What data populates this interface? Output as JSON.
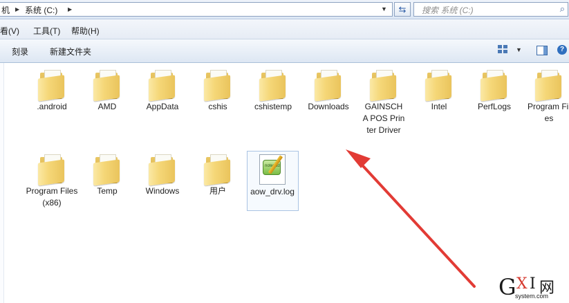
{
  "addressbar": {
    "crumb_computer": "机",
    "crumb_drive": "系统 (C:)",
    "search_placeholder": "搜索 系统 (C:)"
  },
  "menubar": {
    "items": [
      {
        "label": "查看(V)"
      },
      {
        "label": "工具(T)"
      },
      {
        "label": "帮助(H)"
      }
    ]
  },
  "toolbar": {
    "burn_label": "刻录",
    "new_folder_label": "新建文件夹",
    "help_glyph": "?"
  },
  "files": [
    {
      "name": ".android",
      "type": "folder"
    },
    {
      "name": "AMD",
      "type": "folder"
    },
    {
      "name": "AppData",
      "type": "folder"
    },
    {
      "name": "cshis",
      "type": "folder"
    },
    {
      "name": "cshistemp",
      "type": "folder"
    },
    {
      "name": "Downloads",
      "type": "folder"
    },
    {
      "name": "GAINSCHA POS Printer Driver",
      "type": "folder"
    },
    {
      "name": "Intel",
      "type": "folder"
    },
    {
      "name": "PerfLogs",
      "type": "folder"
    },
    {
      "name": "Program Files",
      "type": "folder"
    },
    {
      "name": "Program Files (x86)",
      "type": "folder"
    },
    {
      "name": "Temp",
      "type": "folder"
    },
    {
      "name": "Windows",
      "type": "folder"
    },
    {
      "name": "用户",
      "type": "folder"
    },
    {
      "name": "aow_drv.log",
      "type": "log-file",
      "selected": true
    }
  ],
  "watermark": {
    "g": "G",
    "x": "X",
    "i": "I",
    "wang": "网",
    "domain": "system.com"
  },
  "colors": {
    "arrow": "#e23b35",
    "folder": "#f5d778",
    "selection": "#a9c3e3"
  }
}
